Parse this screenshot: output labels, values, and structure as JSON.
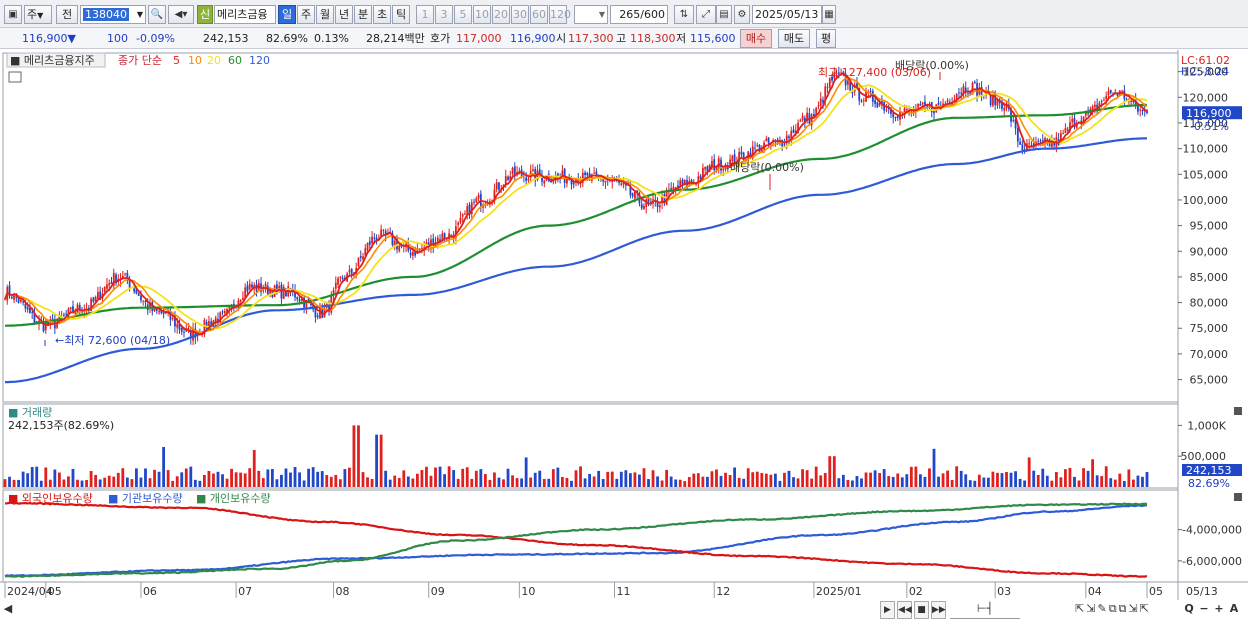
{
  "toolbar": {
    "period_select": "주",
    "prev_label": "전",
    "stock_code": "138040",
    "sin_label": "신",
    "stock_name": "메리츠금융",
    "period_buttons": [
      "일",
      "주",
      "월",
      "년",
      "분",
      "초",
      "틱"
    ],
    "active_period": "일",
    "interval_buttons": [
      "1",
      "3",
      "5",
      "10",
      "20",
      "30",
      "60",
      "120"
    ],
    "count_value": "265",
    "count_max": "/600",
    "date_value": "2025/05/13"
  },
  "quote": {
    "price": "116,900",
    "direction_mark": "▼",
    "change": "100",
    "change_pct": "-0.09%",
    "volume": "242,153",
    "volume_ratio": "82.69%",
    "turnover_ratio": "0.13%",
    "amount": "28,214백만",
    "bid_label": "호가",
    "bid_price": "117,000",
    "ask_price": "116,900",
    "open_label": "시",
    "open_price": "117,300",
    "high_label": "고",
    "high_price": "118,300",
    "low_label": "저",
    "low_price": "115,600",
    "buy_button": "매수",
    "sell_button": "매도",
    "extra_button": "평"
  },
  "colors": {
    "candle_up": "#e01f1f",
    "candle_down": "#1f47c8",
    "ma5": "#e01f1f",
    "ma10": "#ff8a00",
    "ma20": "#f4e21a",
    "ma60": "#1f8f2e",
    "ma120": "#2e5bd8",
    "foreign": "#d81414",
    "institution": "#2e5bd8",
    "individual": "#2f8a4a"
  },
  "chart_data": [
    {
      "type": "candlestick",
      "title": "메리츠금융지주",
      "legend_prefix": "종가 단순",
      "ma_periods": [
        "5",
        "10",
        "20",
        "60",
        "120"
      ],
      "y_ticks": [
        "125,000",
        "120,000",
        "115,000",
        "110,000",
        "105,000",
        "100,000",
        "95,000",
        "90,000",
        "85,000",
        "80,000",
        "75,000",
        "70,000",
        "65,000"
      ],
      "ylim": [
        61020,
        128240
      ],
      "lc_label": "LC:61.02",
      "hc_label": "HC:-8.24",
      "current_price_label": "116,900",
      "current_pct_label": "-0.51%",
      "annotations": {
        "high": "최고 127,400 (03/06)",
        "low": "최저 72,600 (04/18)",
        "dividend1": "배당락(0.00%)",
        "dividend2": "배당락(0.00%)"
      },
      "x_labels": [
        "2024/04",
        "05",
        "06",
        "07",
        "08",
        "09",
        "10",
        "11",
        "12",
        "2025/01",
        "02",
        "03",
        "04",
        "05"
      ],
      "last_x_label": "05/13",
      "close_anchors": [
        [
          0,
          82000
        ],
        [
          18,
          75500
        ],
        [
          35,
          79000
        ],
        [
          50,
          85000
        ],
        [
          68,
          78000
        ],
        [
          82,
          74000
        ],
        [
          95,
          77000
        ],
        [
          108,
          83000
        ],
        [
          125,
          82000
        ],
        [
          140,
          78000
        ],
        [
          150,
          85000
        ],
        [
          165,
          93000
        ],
        [
          180,
          90000
        ],
        [
          195,
          93000
        ],
        [
          210,
          100000
        ],
        [
          225,
          105000
        ],
        [
          240,
          104500
        ],
        [
          265,
          104000
        ],
        [
          285,
          99000
        ],
        [
          300,
          103000
        ],
        [
          315,
          107000
        ],
        [
          340,
          111000
        ],
        [
          355,
          116000
        ],
        [
          367,
          124000
        ],
        [
          380,
          120000
        ],
        [
          395,
          117000
        ],
        [
          410,
          118000
        ],
        [
          425,
          122000
        ],
        [
          440,
          119000
        ],
        [
          450,
          110000
        ],
        [
          462,
          111000
        ],
        [
          475,
          116000
        ],
        [
          490,
          121000
        ],
        [
          504,
          116900
        ]
      ],
      "ma60_anchors": [
        [
          0,
          75500
        ],
        [
          60,
          79000
        ],
        [
          120,
          79500
        ],
        [
          180,
          85000
        ],
        [
          240,
          95000
        ],
        [
          300,
          102000
        ],
        [
          360,
          108000
        ],
        [
          420,
          116000
        ],
        [
          460,
          116500
        ],
        [
          504,
          118500
        ]
      ],
      "ma120_anchors": [
        [
          0,
          64500
        ],
        [
          60,
          71000
        ],
        [
          120,
          78500
        ],
        [
          180,
          81500
        ],
        [
          240,
          87000
        ],
        [
          300,
          94000
        ],
        [
          360,
          101000
        ],
        [
          420,
          107000
        ],
        [
          460,
          110000
        ],
        [
          504,
          112000
        ]
      ]
    },
    {
      "type": "bar",
      "title": "거래량",
      "summary": "242,153주(82.69%)",
      "y_ticks": [
        "1,000K",
        "500,000"
      ],
      "ylim": [
        0,
        1250000
      ],
      "current_label": "242,153",
      "current_pct": "82.69%",
      "spikes": [
        [
          70,
          650000
        ],
        [
          155,
          1000000
        ],
        [
          165,
          850000
        ],
        [
          110,
          600000
        ],
        [
          230,
          480000
        ],
        [
          365,
          500000
        ],
        [
          410,
          620000
        ],
        [
          452,
          480000
        ],
        [
          480,
          450000
        ]
      ],
      "base_volume": 270000
    },
    {
      "type": "line",
      "series_labels": [
        "외국인보유수량",
        "기관보유수량",
        "개인보유수량"
      ],
      "y_ticks": [
        "-4,000,000",
        "-6,000,000"
      ],
      "foreign_anchors": [
        [
          0,
          0.03
        ],
        [
          80,
          0.1
        ],
        [
          150,
          0.25
        ],
        [
          220,
          0.3
        ],
        [
          290,
          0.32
        ],
        [
          360,
          0.55
        ],
        [
          420,
          0.72
        ],
        [
          460,
          0.85
        ],
        [
          504,
          0.93
        ]
      ],
      "institution_anchors": [
        [
          0,
          0.96
        ],
        [
          80,
          0.9
        ],
        [
          140,
          0.72
        ],
        [
          200,
          0.55
        ],
        [
          260,
          0.42
        ],
        [
          330,
          0.28
        ],
        [
          400,
          0.18
        ],
        [
          460,
          0.06
        ],
        [
          504,
          0.02
        ]
      ],
      "individual_anchors": [
        [
          0,
          0.02
        ],
        [
          60,
          0.06
        ],
        [
          120,
          0.12
        ],
        [
          150,
          0.22
        ],
        [
          200,
          0.48
        ],
        [
          260,
          0.62
        ],
        [
          330,
          0.75
        ],
        [
          400,
          0.86
        ],
        [
          460,
          0.94
        ],
        [
          504,
          0.95
        ]
      ]
    }
  ],
  "bottom": {
    "nav_buttons": [
      "▶",
      "◀◀",
      "■",
      "▶▶"
    ],
    "zoom_buttons": [
      "Q",
      "−",
      "+",
      "A"
    ]
  }
}
